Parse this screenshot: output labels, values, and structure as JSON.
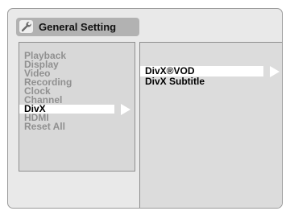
{
  "window": {
    "title": "General Setting",
    "icon": "wrench-icon"
  },
  "menu": {
    "items": [
      {
        "label": "Playback"
      },
      {
        "label": "Display"
      },
      {
        "label": "Video"
      },
      {
        "label": "Recording"
      },
      {
        "label": "Clock"
      },
      {
        "label": "Channel"
      },
      {
        "label": "DivX",
        "selected": true
      },
      {
        "label": "HDMI"
      },
      {
        "label": "Reset All"
      }
    ]
  },
  "submenu": {
    "items": [
      {
        "label": "DivX®VOD",
        "selected": true
      },
      {
        "label": "DivX Subtitle"
      }
    ]
  },
  "colors": {
    "background": "#e9e9e9",
    "title_bar": "#b2b2b2",
    "menu_panel": "#d8d8d8",
    "inactive_text": "#909090",
    "active_text": "#000000",
    "highlight": "#ffffff"
  }
}
